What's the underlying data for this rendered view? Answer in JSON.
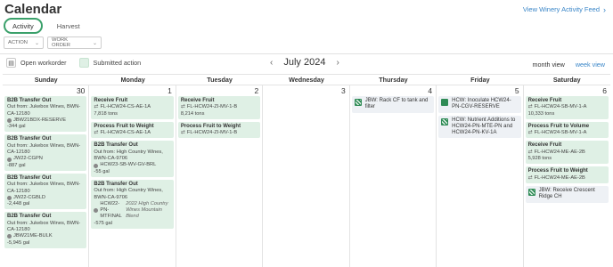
{
  "page": {
    "title": "Calendar",
    "feed_link": "View Winery Activity Feed",
    "tabs": [
      "Activity",
      "Harvest"
    ],
    "filters": {
      "action": "ACTION",
      "work_order": "WORK ORDER"
    }
  },
  "legend": {
    "open": "Open workorder",
    "submitted": "Submitted action"
  },
  "nav": {
    "month": "July 2024",
    "month_view": "month view",
    "week_view": "week view"
  },
  "weekdays": [
    "Sunday",
    "Monday",
    "Tuesday",
    "Wednesday",
    "Thursday",
    "Friday",
    "Saturday"
  ],
  "days": [
    {
      "num": "30",
      "events": [
        {
          "type": "transfer",
          "title": "B2B Transfer Out",
          "line": "Out from:  Jukebox Wines, BWN-CA-12180",
          "lot": "JBW21BDX-RESERVE",
          "qty": "-344 gal"
        },
        {
          "type": "transfer",
          "title": "B2B Transfer Out",
          "line": "Out from:  Jukebox Wines, BWN-CA-12180",
          "lot": "JW22-CGPN",
          "qty": "-887 gal"
        },
        {
          "type": "transfer",
          "title": "B2B Transfer Out",
          "line": "Out from:  Jukebox Wines, BWN-CA-12180",
          "lot": "JW22-CGBLD",
          "qty": "-2,448 gal"
        },
        {
          "type": "transfer",
          "title": "B2B Transfer Out",
          "line": "Out from:  Jukebox Wines, BWN-CA-12180",
          "lot": "JBW21ME-BULK",
          "qty": "-5,945 gal"
        }
      ]
    },
    {
      "num": "1",
      "events": [
        {
          "type": "fruit",
          "title": "Receive Fruit",
          "lot": "FL-HCW24-CS-AE-1A",
          "qty": "7,818 tons"
        },
        {
          "type": "fruit",
          "title": "Process Fruit to Weight",
          "lot": "FL-HCW24-CS-AE-1A",
          "qty": ""
        },
        {
          "type": "transfer",
          "title": "B2B Transfer Out",
          "line": "Out from:  High Country Wines, BWN-CA-9706",
          "lot": "HCW23-SB-WV-GV-BRL",
          "qty": "-55 gal"
        },
        {
          "type": "transfer",
          "title": "B2B Transfer Out",
          "line": "Out from:  High Country Wines, BWN-CA-9706",
          "lot": "HCW22-PN-MTFINAL",
          "note": "2022 High Country Wines Mountain Blend",
          "qty": "-575 gal"
        }
      ]
    },
    {
      "num": "2",
      "events": [
        {
          "type": "fruit",
          "title": "Receive Fruit",
          "lot": "FL-HCW24-ZI-MV-1-B",
          "qty": "8,214 tons"
        },
        {
          "type": "fruit",
          "title": "Process Fruit to Weight",
          "lot": "FL-HCW24-ZI-MV-1-B",
          "qty": ""
        }
      ]
    },
    {
      "num": "3",
      "events": []
    },
    {
      "num": "4",
      "events": [
        {
          "type": "job",
          "icon": "striped",
          "title": "JBW: Rack CF to tank and filter"
        }
      ]
    },
    {
      "num": "5",
      "events": [
        {
          "type": "job",
          "icon": "solid",
          "title": "HCW: Inoculate HCW24-PN-CGV-RESERVE"
        },
        {
          "type": "job",
          "icon": "striped",
          "title": "HCW: Nutrient Additions to HCW24-PN-MTE-PN and HCW24-PN-KV-1A"
        }
      ]
    },
    {
      "num": "6",
      "events": [
        {
          "type": "fruit",
          "title": "Receive Fruit",
          "lot": "FL-HCW24-SB-MV-1-A",
          "qty": "10,333 tons"
        },
        {
          "type": "fruit",
          "title": "Process Fruit to Volume",
          "lot": "FL-HCW24-SB-MV-1-A",
          "qty": ""
        },
        {
          "type": "fruit",
          "title": "Receive Fruit",
          "lot": "FL-HCW24-ME-AE-2B",
          "qty": "5,928 tons"
        },
        {
          "type": "fruit",
          "title": "Process Fruit to Weight",
          "lot": "FL-HCW24-ME-AE-2B",
          "qty": ""
        },
        {
          "type": "job",
          "icon": "striped",
          "title": "JBW: Receive Crescent Ridge CH"
        }
      ]
    }
  ]
}
